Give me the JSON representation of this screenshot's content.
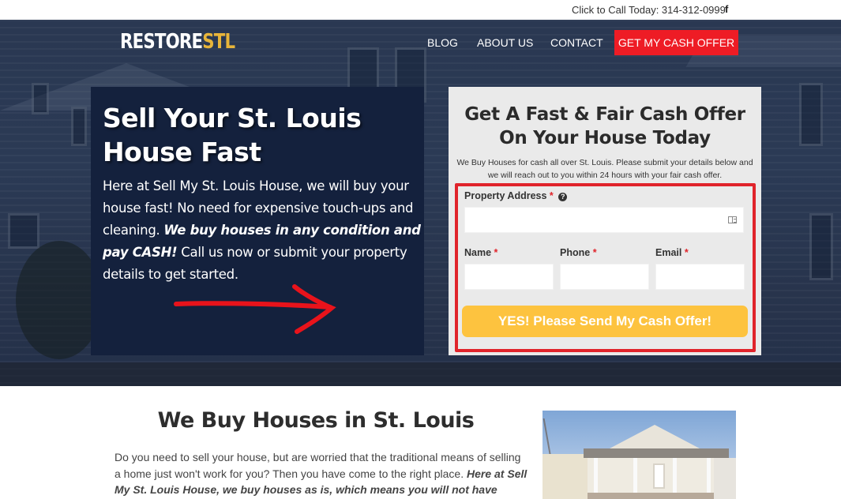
{
  "topbar": {
    "call_text": "Click to Call Today: 314-312-0999",
    "social_icon": "facebook-icon",
    "social_glyph": "f"
  },
  "header": {
    "logo_main": "RESTORE",
    "logo_accent": "STL",
    "nav": [
      {
        "label": "BLOG"
      },
      {
        "label": "ABOUT US"
      },
      {
        "label": "CONTACT"
      }
    ],
    "cta_label": "GET MY CASH OFFER"
  },
  "hero": {
    "title": "Sell Your St. Louis House Fast",
    "body_intro": "Here at Sell My St. Louis House, we will buy your house fast! No need for expensive touch-ups and cleaning. ",
    "body_emphasis": "We buy houses in any condition and pay CASH!",
    "body_outro": " Call us now or submit your property details to get started.",
    "arrow_icon": "red-arrow-right-icon"
  },
  "form": {
    "title": "Get A Fast & Fair Cash Offer On Your House Today",
    "intro": "We Buy Houses for cash all over St. Louis. Please submit your details below and we will reach out to you within 24 hours with your fair cash offer.",
    "address_label": "Property Address",
    "name_label": "Name",
    "phone_label": "Phone",
    "email_label": "Email",
    "required_marker": "*",
    "help_glyph": "?",
    "address_value": "",
    "name_value": "",
    "phone_value": "",
    "email_value": "",
    "submit_label": "YES! Please Send My Cash Offer!"
  },
  "section2": {
    "title": "We Buy Houses in St. Louis",
    "body_intro": "Do you need to sell your house, but are worried that the traditional means of selling a home just won't work for you? Then you have come to the right place. ",
    "body_emphasis": "Here at Sell My St. Louis House, we buy houses as is, which means you will not have"
  },
  "colors": {
    "cta_red": "#ee1c25",
    "logo_gold": "#e8b53a",
    "submit_yellow": "#fdc33f",
    "panel_navy": "#14213d",
    "highlight_red": "#e0242b"
  }
}
